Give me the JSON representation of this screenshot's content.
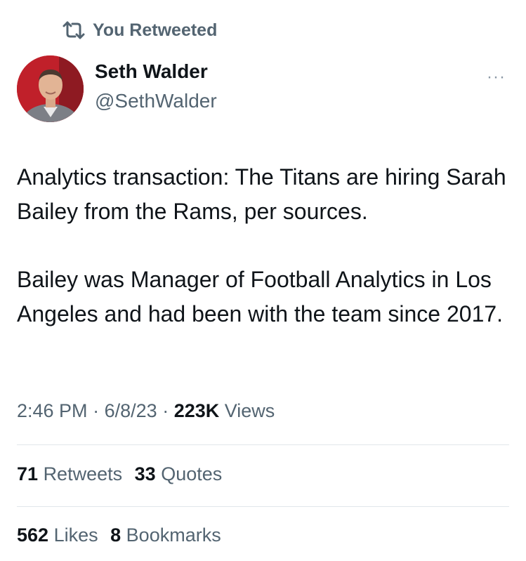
{
  "retweet": {
    "label": "You Retweeted",
    "icon": "retweet-icon"
  },
  "author": {
    "name": "Seth Walder",
    "handle": "@SethWalder",
    "more_icon": "more-dots-icon",
    "more_glyph": "···"
  },
  "tweet": {
    "paragraphs": [
      "Analytics transaction: The Titans are hiring Sarah Bailey from the Rams, per sources.",
      "Bailey was Manager of Football Analytics in Los Angeles and had been with the team since 2017."
    ]
  },
  "meta": {
    "time": "2:46 PM",
    "sep1": "·",
    "date": "6/8/23",
    "sep2": "·",
    "views_count": "223K",
    "views_label": "Views"
  },
  "stats": {
    "retweets_count": "71",
    "retweets_label": "Retweets",
    "quotes_count": "33",
    "quotes_label": "Quotes",
    "likes_count": "562",
    "likes_label": "Likes",
    "bookmarks_count": "8",
    "bookmarks_label": "Bookmarks"
  },
  "colors": {
    "text": "#0f1419",
    "secondary": "#536471",
    "divider": "#e1e6ea",
    "avatar_bg": "#c0202a"
  }
}
